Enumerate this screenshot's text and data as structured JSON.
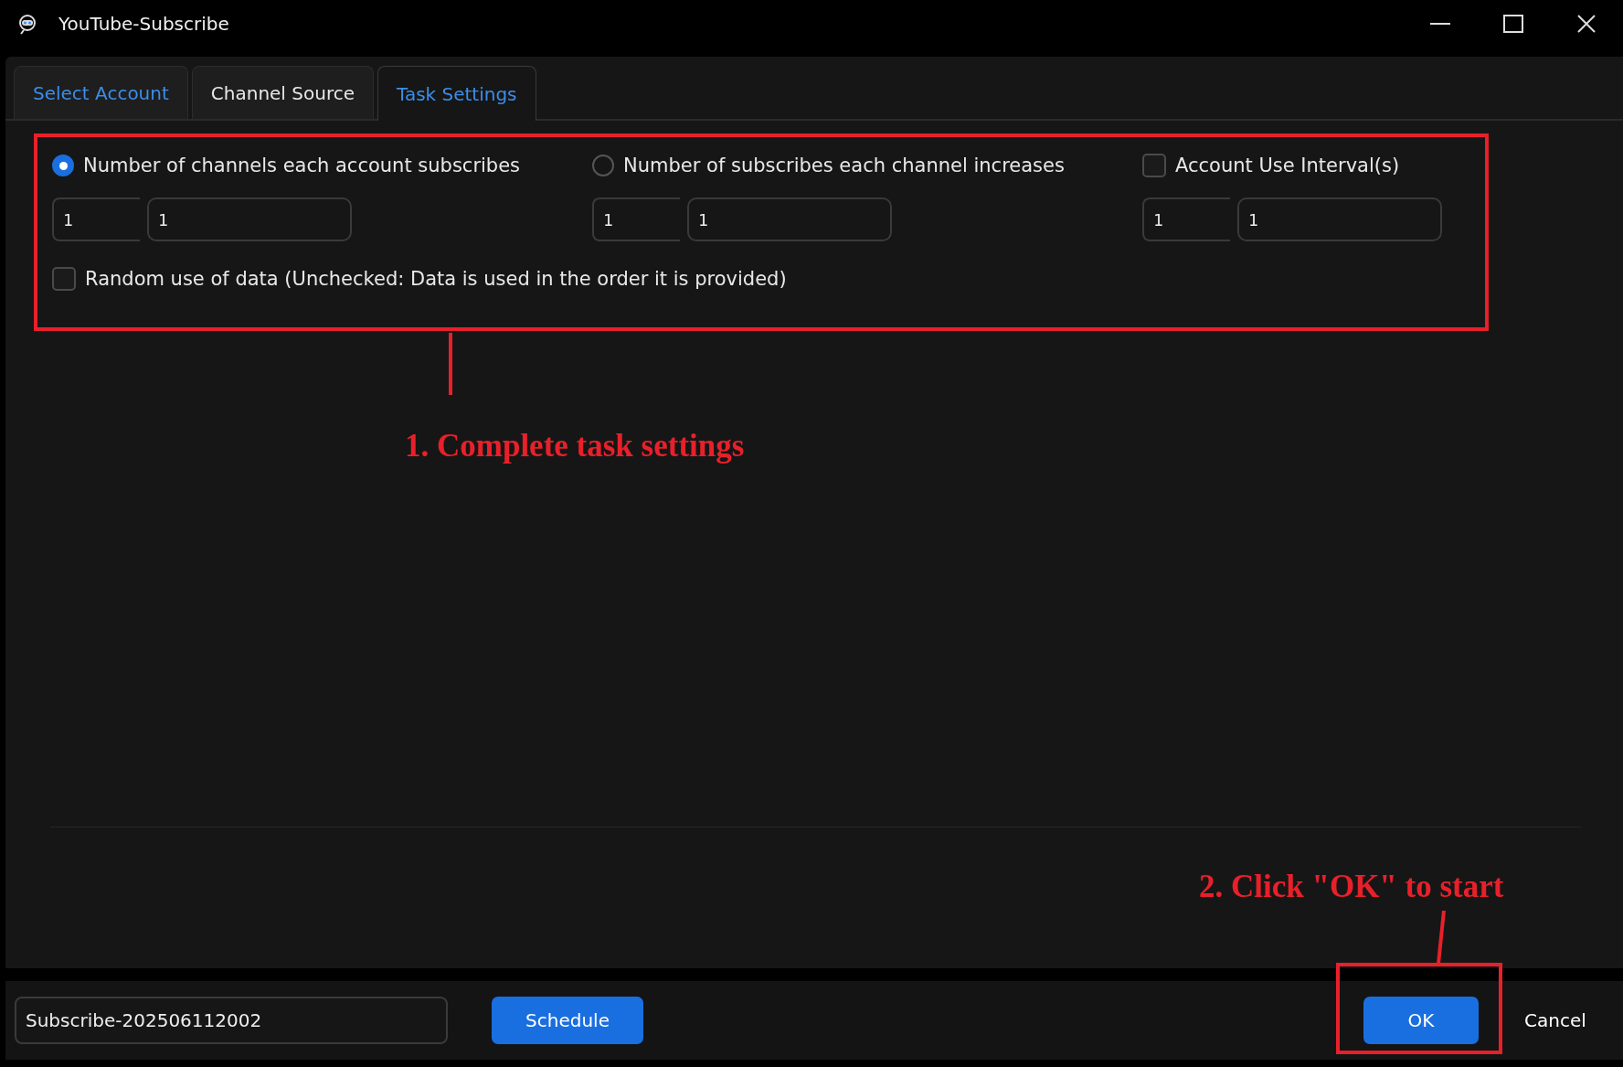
{
  "window": {
    "title": "YouTube-Subscribe"
  },
  "tabs": [
    {
      "label": "Select Account",
      "selected": false,
      "color": "#3b8eea"
    },
    {
      "label": "Channel Source",
      "selected": false,
      "color": "#e8e8e8"
    },
    {
      "label": "Task Settings",
      "selected": true,
      "color": "#3b8eea"
    }
  ],
  "settings": {
    "options": [
      {
        "kind": "radio",
        "label": "Number of channels each account subscribes",
        "checked": true,
        "values": [
          "1",
          "1"
        ]
      },
      {
        "kind": "radio",
        "label": "Number of subscribes each channel increases",
        "checked": false,
        "values": [
          "1",
          "1"
        ]
      },
      {
        "kind": "checkbox",
        "label": "Account Use Interval(s)",
        "checked": false,
        "values": [
          "1",
          "1"
        ]
      }
    ],
    "random": {
      "label": "Random use of data (Unchecked: Data is used in the order it is provided)",
      "checked": false
    }
  },
  "footer": {
    "task_name": "Subscribe-202506112002",
    "buttons": [
      "Schedule",
      "OK",
      "Cancel"
    ]
  },
  "annotations": [
    {
      "text": "1. Complete task settings"
    },
    {
      "text": "2. Click \"OK\" to start"
    }
  ]
}
